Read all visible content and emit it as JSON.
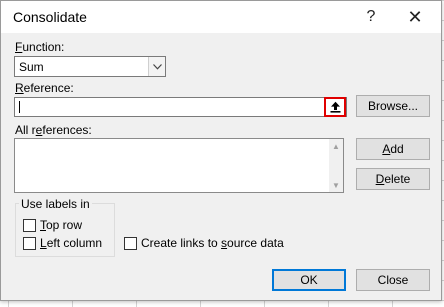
{
  "dialog": {
    "title": "Consolidate",
    "help_glyph": "?",
    "close_glyph": "✕"
  },
  "function": {
    "label_prefix": "",
    "label_access": "F",
    "label_rest": "unction:",
    "selected": "Sum"
  },
  "reference": {
    "label_access": "R",
    "label_rest": "eference:",
    "value": "",
    "collapse_icon": "upload-arrow-icon",
    "browse_label": "Browse..."
  },
  "all_references": {
    "label_pre": "All r",
    "label_access": "e",
    "label_rest": "ferences:",
    "items": []
  },
  "buttons": {
    "add": "Add",
    "delete": "Delete",
    "ok": "OK",
    "close": "Close"
  },
  "use_labels": {
    "legend": "Use labels in",
    "top_row": {
      "access": "T",
      "rest": "op row",
      "checked": false
    },
    "left_column": {
      "access": "L",
      "rest": "eft column",
      "checked": false
    }
  },
  "create_links": {
    "pre": "Create links to ",
    "access": "s",
    "rest": "ource data",
    "checked": false
  },
  "colors": {
    "accent": "#0078d7",
    "highlight_border": "#e00000",
    "dialog_bg": "#f0f0f0"
  }
}
